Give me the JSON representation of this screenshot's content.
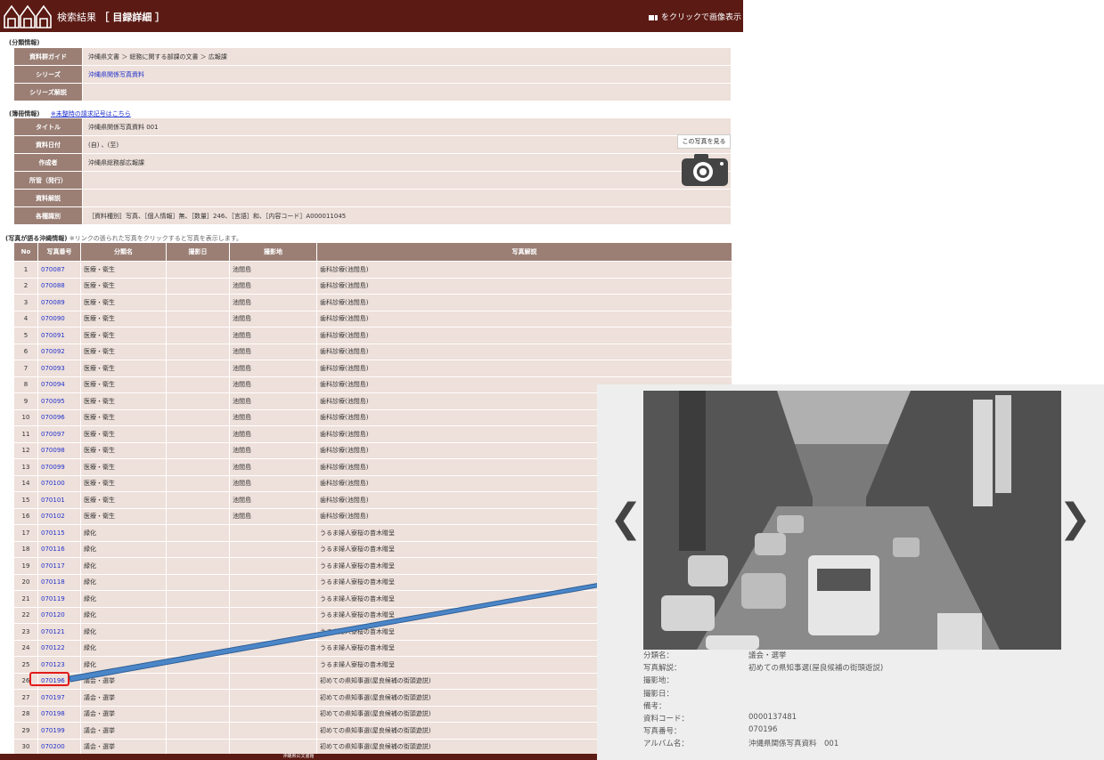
{
  "header": {
    "title_prefix": "検索結果",
    "title_bracket": "［ 目録詳細 ］",
    "hint": "をクリックで画像表示"
  },
  "classification": {
    "label": "(分類情報)",
    "rows": [
      {
        "key": "資料群ガイド",
        "value": "沖縄県文書 ＞ 総務に関する部課の文書 ＞ 広報課"
      },
      {
        "key": "シリーズ",
        "value": "沖縄県関係写真資料"
      },
      {
        "key": "シリーズ解説",
        "value": ""
      }
    ]
  },
  "book": {
    "label": "(簿冊情報)",
    "link": "※未整時の請求記号はこちら",
    "rows": [
      {
        "key": "タイトル",
        "value": "沖縄県関係写真資料 001"
      },
      {
        "key": "資料日付",
        "value": "(自) 、(至)"
      },
      {
        "key": "作成者",
        "value": "沖縄県総務部広報課"
      },
      {
        "key": "所管（発行）",
        "value": ""
      },
      {
        "key": "資料解説",
        "value": ""
      },
      {
        "key": "各種識別",
        "value": "［資料種別］写真、［個人情報］無、［数量］246、［言語］和、［内容コード］A000011045"
      }
    ],
    "camera_label": "この写真を見る"
  },
  "photos": {
    "label": "(写真が語る沖縄情報)",
    "note": "※リンクの張られた写真をクリックすると写真を表示します。",
    "headers": [
      "No",
      "写真番号",
      "分類名",
      "撮影日",
      "撮影地",
      "写真解説"
    ],
    "rows": [
      {
        "no": "1",
        "id": "070087",
        "cat": "医療・衛生",
        "date": "",
        "place": "池間島",
        "desc": "歯科診療(池間島)"
      },
      {
        "no": "2",
        "id": "070088",
        "cat": "医療・衛生",
        "date": "",
        "place": "池間島",
        "desc": "歯科診療(池間島)"
      },
      {
        "no": "3",
        "id": "070089",
        "cat": "医療・衛生",
        "date": "",
        "place": "池間島",
        "desc": "歯科診療(池間島)"
      },
      {
        "no": "4",
        "id": "070090",
        "cat": "医療・衛生",
        "date": "",
        "place": "池間島",
        "desc": "歯科診療(池間島)"
      },
      {
        "no": "5",
        "id": "070091",
        "cat": "医療・衛生",
        "date": "",
        "place": "池間島",
        "desc": "歯科診療(池間島)"
      },
      {
        "no": "6",
        "id": "070092",
        "cat": "医療・衛生",
        "date": "",
        "place": "池間島",
        "desc": "歯科診療(池間島)"
      },
      {
        "no": "7",
        "id": "070093",
        "cat": "医療・衛生",
        "date": "",
        "place": "池間島",
        "desc": "歯科診療(池間島)"
      },
      {
        "no": "8",
        "id": "070094",
        "cat": "医療・衛生",
        "date": "",
        "place": "池間島",
        "desc": "歯科診療(池間島)"
      },
      {
        "no": "9",
        "id": "070095",
        "cat": "医療・衛生",
        "date": "",
        "place": "池間島",
        "desc": "歯科診療(池間島)"
      },
      {
        "no": "10",
        "id": "070096",
        "cat": "医療・衛生",
        "date": "",
        "place": "池間島",
        "desc": "歯科診療(池間島)"
      },
      {
        "no": "11",
        "id": "070097",
        "cat": "医療・衛生",
        "date": "",
        "place": "池間島",
        "desc": "歯科診療(池間島)"
      },
      {
        "no": "12",
        "id": "070098",
        "cat": "医療・衛生",
        "date": "",
        "place": "池間島",
        "desc": "歯科診療(池間島)"
      },
      {
        "no": "13",
        "id": "070099",
        "cat": "医療・衛生",
        "date": "",
        "place": "池間島",
        "desc": "歯科診療(池間島)"
      },
      {
        "no": "14",
        "id": "070100",
        "cat": "医療・衛生",
        "date": "",
        "place": "池間島",
        "desc": "歯科診療(池間島)"
      },
      {
        "no": "15",
        "id": "070101",
        "cat": "医療・衛生",
        "date": "",
        "place": "池間島",
        "desc": "歯科診療(池間島)"
      },
      {
        "no": "16",
        "id": "070102",
        "cat": "医療・衛生",
        "date": "",
        "place": "池間島",
        "desc": "歯科診療(池間島)"
      },
      {
        "no": "17",
        "id": "070115",
        "cat": "緑化",
        "date": "",
        "place": "",
        "desc": "うるま婦人寮桜の苗木贈呈"
      },
      {
        "no": "18",
        "id": "070116",
        "cat": "緑化",
        "date": "",
        "place": "",
        "desc": "うるま婦人寮桜の苗木贈呈"
      },
      {
        "no": "19",
        "id": "070117",
        "cat": "緑化",
        "date": "",
        "place": "",
        "desc": "うるま婦人寮桜の苗木贈呈"
      },
      {
        "no": "20",
        "id": "070118",
        "cat": "緑化",
        "date": "",
        "place": "",
        "desc": "うるま婦人寮桜の苗木贈呈"
      },
      {
        "no": "21",
        "id": "070119",
        "cat": "緑化",
        "date": "",
        "place": "",
        "desc": "うるま婦人寮桜の苗木贈呈"
      },
      {
        "no": "22",
        "id": "070120",
        "cat": "緑化",
        "date": "",
        "place": "",
        "desc": "うるま婦人寮桜の苗木贈呈"
      },
      {
        "no": "23",
        "id": "070121",
        "cat": "緑化",
        "date": "",
        "place": "",
        "desc": "うるま婦人寮桜の苗木贈呈"
      },
      {
        "no": "24",
        "id": "070122",
        "cat": "緑化",
        "date": "",
        "place": "",
        "desc": "うるま婦人寮桜の苗木贈呈"
      },
      {
        "no": "25",
        "id": "070123",
        "cat": "緑化",
        "date": "",
        "place": "",
        "desc": "うるま婦人寮桜の苗木贈呈"
      },
      {
        "no": "26",
        "id": "070196",
        "cat": "議会・選挙",
        "date": "",
        "place": "",
        "desc": "初めての県知事選(屋良候補の街頭遊説)"
      },
      {
        "no": "27",
        "id": "070197",
        "cat": "議会・選挙",
        "date": "",
        "place": "",
        "desc": "初めての県知事選(屋良候補の街頭遊説)"
      },
      {
        "no": "28",
        "id": "070198",
        "cat": "議会・選挙",
        "date": "",
        "place": "",
        "desc": "初めての県知事選(屋良候補の街頭遊説)"
      },
      {
        "no": "29",
        "id": "070199",
        "cat": "議会・選挙",
        "date": "",
        "place": "",
        "desc": "初めての県知事選(屋良候補の街頭遊説)"
      },
      {
        "no": "30",
        "id": "070200",
        "cat": "議会・選挙",
        "date": "",
        "place": "",
        "desc": "初めての県知事選(屋良候補の街頭遊説)"
      }
    ]
  },
  "footer": "沖縄県公文書館",
  "viewer": {
    "prev": "❮",
    "next": "❯",
    "meta": [
      {
        "key": "分類名：",
        "value": "議会・選挙"
      },
      {
        "key": "写真解説：",
        "value": "初めての県知事選(屋良候補の街頭遊説)"
      },
      {
        "key": "撮影地：",
        "value": ""
      },
      {
        "key": "撮影日：",
        "value": ""
      },
      {
        "key": "備考：",
        "value": ""
      },
      {
        "key": "資料コード：",
        "value": "0000137481"
      },
      {
        "key": "写真番号：",
        "value": "070196"
      },
      {
        "key": "アルバム名：",
        "value": "沖縄県関係写真資料　001"
      }
    ]
  },
  "colors": {
    "header_bg": "#5b1a14",
    "label_bg": "#9b7f75",
    "cell_bg": "#eee0da",
    "link": "#2233cc",
    "highlight": "#e31b1b",
    "arrow": "#4a86c8"
  }
}
